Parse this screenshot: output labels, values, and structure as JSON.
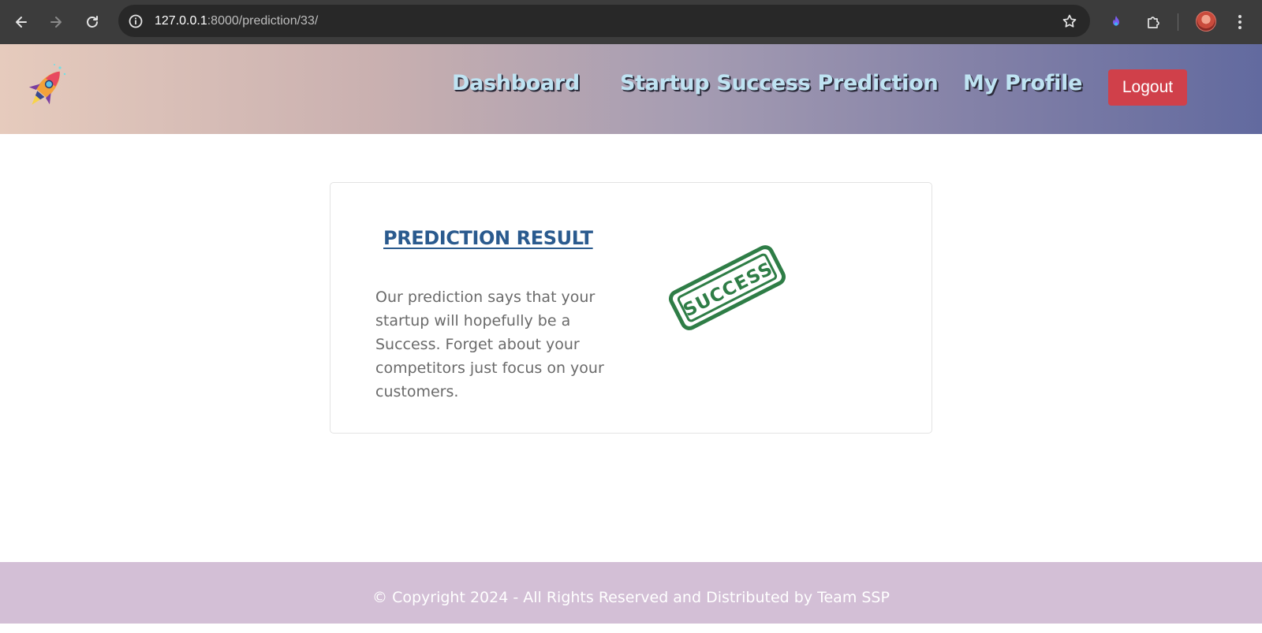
{
  "browser": {
    "url_host": "127.0.0.1",
    "url_path": ":8000/prediction/33/",
    "icons": [
      "back-icon",
      "forward-icon",
      "reload-icon",
      "site-info-icon",
      "bookmark-star-icon",
      "extension-flame-icon",
      "extensions-puzzle-icon",
      "profile-avatar",
      "menu-kebab-icon"
    ]
  },
  "header": {
    "logo": "rocket-logo",
    "nav": {
      "dashboard": "Dashboard",
      "prediction": "Startup Success Prediction",
      "profile": "My Profile"
    },
    "logout_label": "Logout",
    "colors": {
      "logout_bg": "#d0404a",
      "nav_text": "#bfe3f2"
    }
  },
  "result": {
    "title": "PREDICTION RESULT",
    "message": "Our prediction says that your startup will hopefully be a Success. Forget about your competitors just focus on your customers.",
    "stamp_text": "SUCCESS",
    "colors": {
      "title": "#2a5a8e",
      "stamp": "#2e7d46"
    }
  },
  "footer": {
    "copyright": "© Copyright 2024 - All Rights Reserved and Distributed by Team SSP",
    "colors": {
      "bg": "#d3bfd6"
    }
  }
}
